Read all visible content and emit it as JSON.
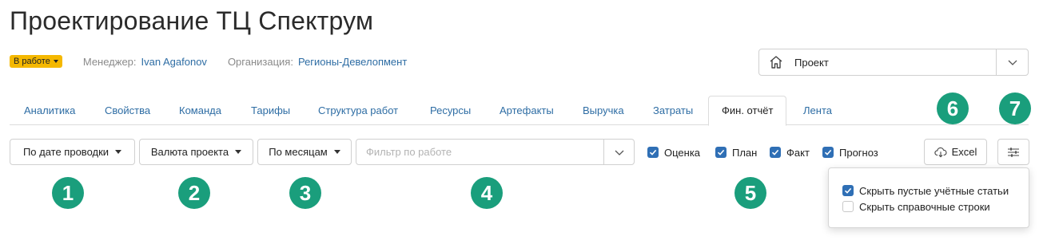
{
  "title": "Проектирование ТЦ Спектрум",
  "status": {
    "label": "В работе",
    "color": "#f5b800"
  },
  "meta": {
    "manager_label": "Менеджер:",
    "manager_value": "Ivan Agafonov",
    "org_label": "Организация:",
    "org_value": "Регионы-Девелопмент"
  },
  "project_select": {
    "label": "Проект",
    "icon": "home-icon"
  },
  "tabs": [
    {
      "label": "Аналитика",
      "active": false
    },
    {
      "label": "Свойства",
      "active": false
    },
    {
      "label": "Команда",
      "active": false
    },
    {
      "label": "Тарифы",
      "active": false
    },
    {
      "label": "Структура работ",
      "active": false
    },
    {
      "label": "Ресурсы",
      "active": false
    },
    {
      "label": "Артефакты",
      "active": false
    },
    {
      "label": "Выручка",
      "active": false
    },
    {
      "label": "Затраты",
      "active": false
    },
    {
      "label": "Фин. отчёт",
      "active": true
    },
    {
      "label": "Лента",
      "active": false
    }
  ],
  "toolbar": {
    "date_mode": "По дате проводки",
    "currency": "Валюта проекта",
    "period": "По месяцам",
    "filter_placeholder": "Фильтр по работе",
    "checkboxes": [
      {
        "label": "Оценка",
        "checked": true
      },
      {
        "label": "План",
        "checked": true
      },
      {
        "label": "Факт",
        "checked": true
      },
      {
        "label": "Прогноз",
        "checked": true
      }
    ],
    "excel_label": "Excel"
  },
  "settings_popover": {
    "options": [
      {
        "label": "Скрыть пустые учётные статьи",
        "checked": true
      },
      {
        "label": "Скрыть справочные строки",
        "checked": false
      }
    ]
  },
  "callouts": [
    "1",
    "2",
    "3",
    "4",
    "5",
    "6",
    "7"
  ],
  "colors": {
    "accent": "#2e6da4",
    "callout": "#1a9e7c",
    "checkbox": "#2f6fb5"
  }
}
